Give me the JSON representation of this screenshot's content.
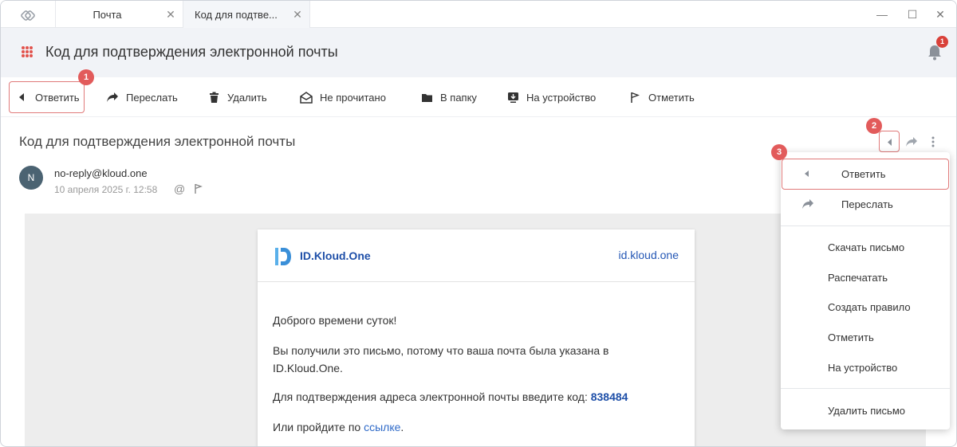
{
  "tabs": [
    {
      "label": "Почта",
      "close": "✕"
    },
    {
      "label": "Код для подтве...",
      "close": "✕"
    }
  ],
  "window_controls": {
    "minimize": "—",
    "maximize": "☐",
    "close": "✕"
  },
  "header": {
    "title": "Код для подтверждения электронной почты",
    "notification_count": "1"
  },
  "toolbar": {
    "reply": "Ответить",
    "forward": "Переслать",
    "delete": "Удалить",
    "unread": "Не прочитано",
    "to_folder": "В папку",
    "to_device": "На устройство",
    "mark": "Отметить"
  },
  "markers": [
    "1",
    "2",
    "3"
  ],
  "message": {
    "subject": "Код для подтверждения электронной почты",
    "avatar_letter": "N",
    "sender": "no-reply@kloud.one",
    "date": "10 апреля 2025 г. 12:58",
    "at_symbol": "@"
  },
  "email": {
    "brand_name": "ID.Kloud.One",
    "brand_link": "id.kloud.one",
    "greeting": "Доброго времени суток!",
    "line1": "Вы получили это письмо, потому что ваша почта была указана в",
    "line1b": "ID.Kloud.One.",
    "line2_prefix": "Для подтверждения адреса электронной почты введите код: ",
    "code": "838484",
    "line3_prefix": "Или пройдите по ",
    "line3_link": "ссылке",
    "line3_suffix": "."
  },
  "dropdown": {
    "reply": "Ответить",
    "forward": "Переслать",
    "download": "Скачать письмо",
    "print": "Распечатать",
    "create_rule": "Создать правило",
    "mark": "Отметить",
    "to_device": "На устройство",
    "delete": "Удалить письмо"
  },
  "colors": {
    "accent_red": "#e25b5b",
    "header_bg": "#f1f3f7",
    "brand_blue": "#1e4fa8"
  }
}
